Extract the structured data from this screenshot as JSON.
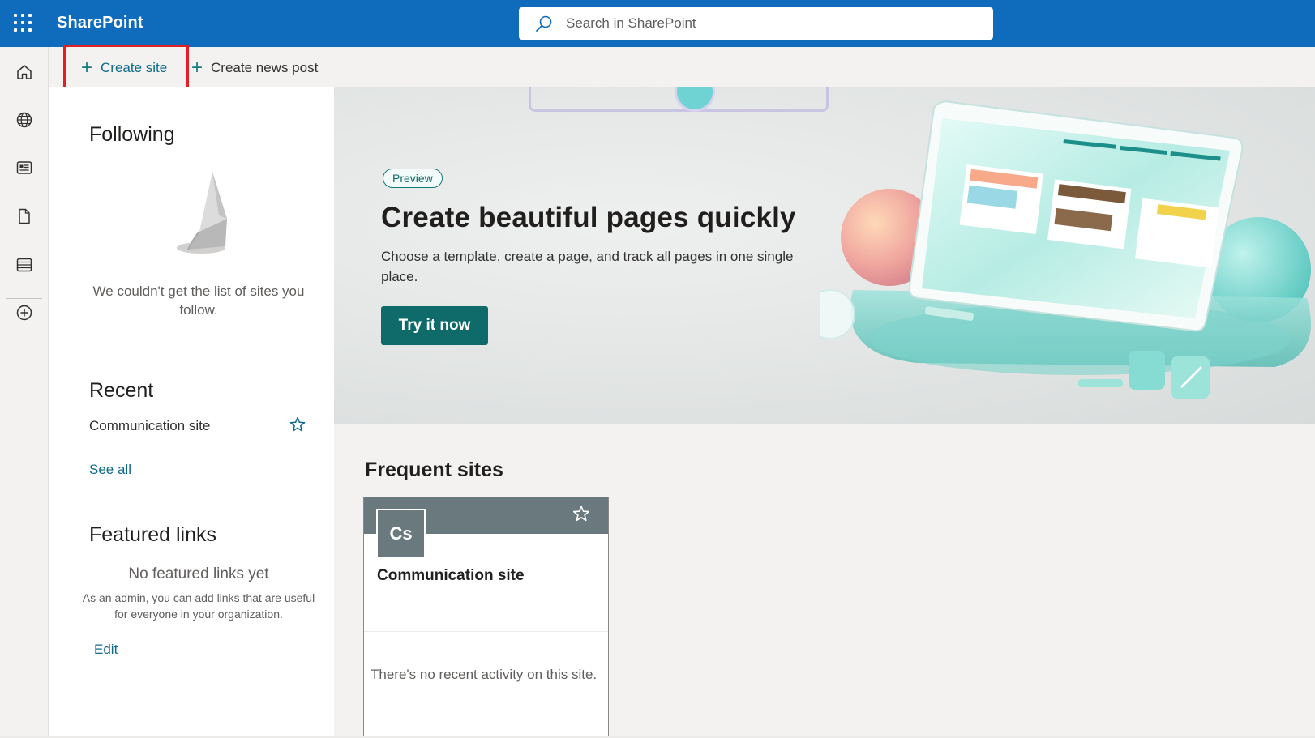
{
  "app": {
    "name": "SharePoint"
  },
  "search": {
    "placeholder": "Search in SharePoint"
  },
  "rail": {
    "items": [
      {
        "name": "home-icon"
      },
      {
        "name": "globe-icon"
      },
      {
        "name": "news-icon"
      },
      {
        "name": "document-icon"
      },
      {
        "name": "list-icon"
      },
      {
        "name": "add-circle-icon"
      }
    ]
  },
  "commandbar": {
    "create_site": "Create site",
    "create_news_post": "Create news post"
  },
  "following": {
    "title": "Following",
    "empty_message": "We couldn't get the list of sites you follow."
  },
  "recent": {
    "title": "Recent",
    "items": [
      {
        "label": "Communication site"
      }
    ],
    "see_all": "See all"
  },
  "featured_links": {
    "title": "Featured links",
    "empty_title": "No featured links yet",
    "empty_subtitle": "As an admin, you can add links that are useful for everyone in your organization.",
    "edit": "Edit"
  },
  "hero": {
    "badge": "Preview",
    "title": "Create beautiful pages quickly",
    "description": "Choose a template, create a page, and track all pages in one single place.",
    "button": "Try it now"
  },
  "frequent_sites": {
    "title": "Frequent sites",
    "cards": [
      {
        "initials": "Cs",
        "name": "Communication site",
        "activity": "There's no recent activity on this site.",
        "banner_color": "#69797e"
      }
    ]
  },
  "colors": {
    "suitebar": "#0f6cbd",
    "accent": "#0f6a6a",
    "highlight": "#e31e24"
  }
}
